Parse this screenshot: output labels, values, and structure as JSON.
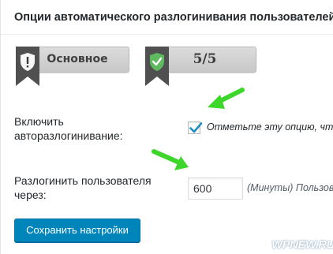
{
  "panel": {
    "title": "Опции автоматического разлогинивания пользователей"
  },
  "badges": [
    {
      "label": "Основное",
      "icon": "shield-warning-icon"
    },
    {
      "label": "5/5",
      "icon": "shield-check-icon"
    }
  ],
  "settings": {
    "enable_label_line1": "Включить",
    "enable_label_line2": "авторазлогинивание:",
    "enable_checked": true,
    "enable_description": "Отметьте эту опцию, чт",
    "logout_label_line1": "Разлогинить пользователя",
    "logout_label_line2": "через:",
    "minutes_value": "600",
    "minutes_description": "(Минуты) Пользов"
  },
  "save_button": {
    "label": "Сохранить настройки"
  },
  "watermark": "WPNEW.RU",
  "colors": {
    "accent": "#0085ba",
    "arrow": "#3dd62a",
    "checkmark": "#1e8cbe"
  }
}
